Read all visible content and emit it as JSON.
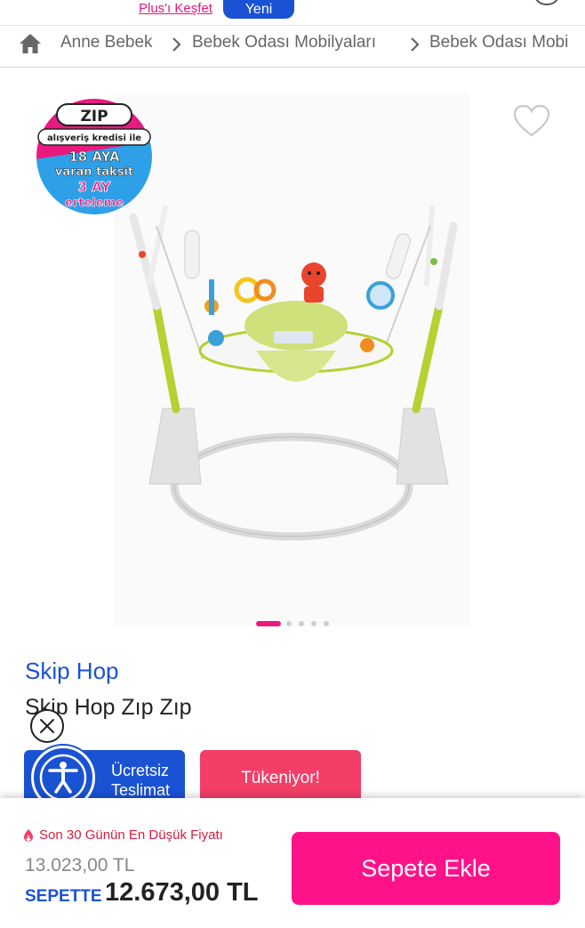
{
  "topbar": {
    "plus_link": "Plus'ı Keşfet",
    "new_badge": "Yeni"
  },
  "breadcrumb": {
    "home_icon": "home-icon",
    "items": [
      "Anne Bebek",
      "Bebek Odası Mobilyaları",
      "Bebek Odası Mobi"
    ]
  },
  "gallery": {
    "zip_badge": {
      "logo": "ZIP",
      "line1": "alışveriş kredisi ile",
      "line2": "18 AYA",
      "line3": "varan taksit",
      "line4": "3 AY",
      "line5": "erteleme"
    },
    "favorite_icon": "heart-outline-icon",
    "pagination_total": 5,
    "pagination_active": 1
  },
  "product": {
    "brand": "Skip Hop",
    "title": "Skip Hop Zıp Zıp",
    "badges": {
      "shipping_line1": "Ücretsiz",
      "shipping_line2": "Teslimat",
      "stock": "Tükeniyor!"
    }
  },
  "purchase": {
    "lowest_price_note": "Son 30 Günün En Düşük Fiyatı",
    "old_price": "13.023,00 TL",
    "cart_label": "SEPETTE",
    "cart_price": "12.673,00 TL",
    "add_to_cart": "Sepete Ekle"
  },
  "colors": {
    "brand_blue": "#1a52d4",
    "accent_pink": "#ff1289",
    "stock_red": "#f33e67"
  }
}
